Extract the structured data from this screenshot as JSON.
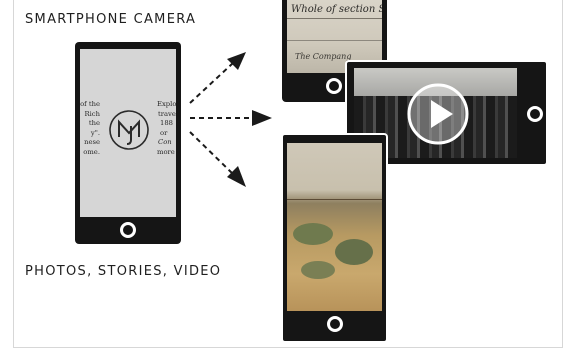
{
  "headings": {
    "top": "SMARTPHONE CAMERA",
    "bottom": "PHOTOS, STORIES, VIDEO"
  },
  "source_phone": {
    "left_column": [
      "of the",
      "Rich",
      "the",
      "y\".",
      "nese",
      "ome."
    ],
    "right_column": [
      "Explor",
      "travel",
      "188",
      "or",
      "Con",
      "more"
    ],
    "logo_letters": "MJ"
  },
  "document_phone": {
    "lines": [
      "Whole of section Sev",
      "The Compang"
    ]
  },
  "icons": {
    "home": "home-button-icon",
    "play": "play-icon",
    "logo": "circle-logo-icon",
    "arrow": "arrow-icon"
  },
  "colors": {
    "phone": "#151515",
    "source_screen": "#d6d6d6",
    "heading_text": "#1f1f1f",
    "arrow": "#1a1a1a"
  }
}
